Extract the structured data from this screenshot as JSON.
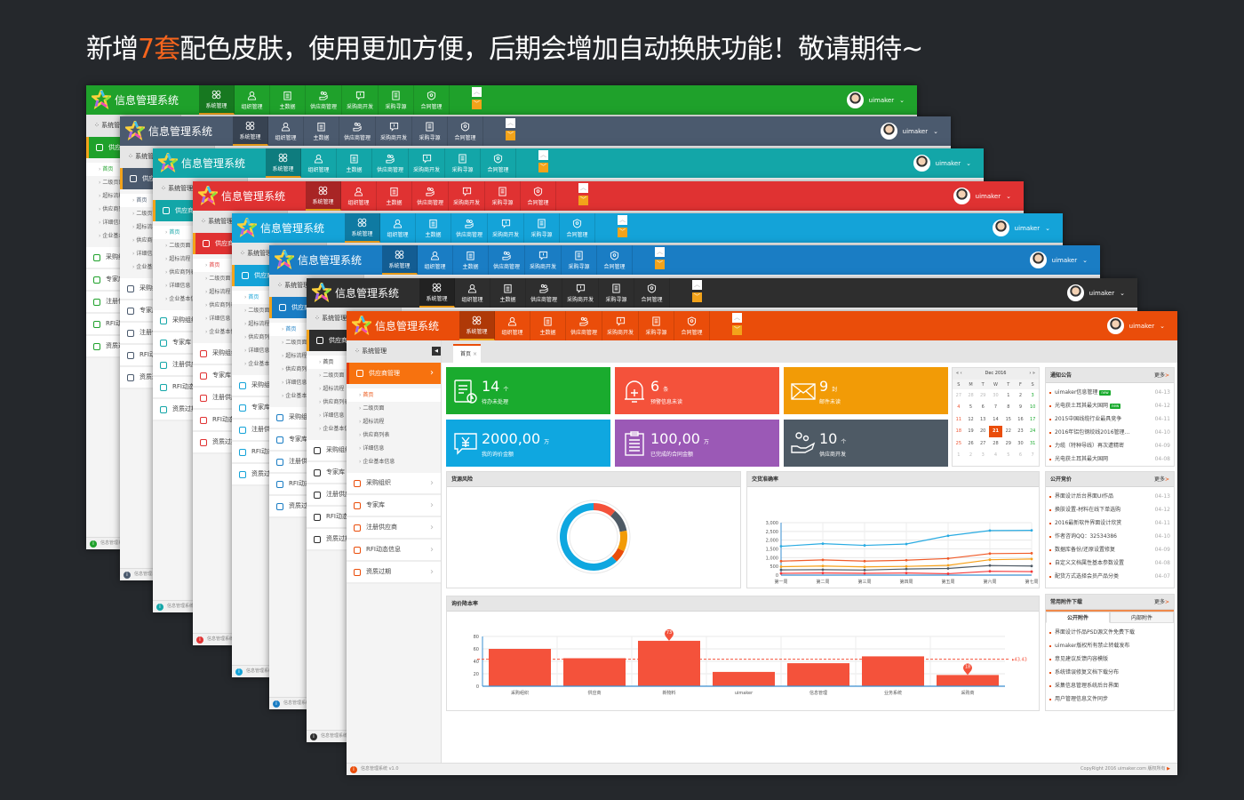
{
  "headline": {
    "prefix": "新增",
    "highlight": "7套",
    "suffix": "配色皮肤，使用更加方便，后期会增加自动换肤功能！敬请期待~"
  },
  "app": {
    "title": "信息管理系统",
    "user": "uimaker",
    "nav": [
      {
        "label": "系统管理",
        "icon": "grid-icon"
      },
      {
        "label": "组织管理",
        "icon": "user-icon"
      },
      {
        "label": "主数据",
        "icon": "clipboard-icon"
      },
      {
        "label": "供应商管理",
        "icon": "supplier-hand-icon"
      },
      {
        "label": "采购商开发",
        "icon": "chat-icon"
      },
      {
        "label": "采购寻源",
        "icon": "document-icon"
      },
      {
        "label": "合同管理",
        "icon": "shield-icon"
      }
    ],
    "sidebar": {
      "header": "系统管理",
      "active": "供应商管理",
      "subitems": [
        "首页",
        "二级页面",
        "超标流程",
        "供应商列表",
        "详细信息",
        "企业基本信息"
      ],
      "items": [
        "采购组织",
        "专家库",
        "注册供应商",
        "RFI动态信息",
        "资质过期"
      ]
    },
    "footer_version": "信息管理系统 v1.0",
    "copyright": "CopyRight 2016  uimaker.com 版权所有"
  },
  "themes": [
    {
      "name": "green",
      "color": "#1fa12b"
    },
    {
      "name": "slate",
      "color": "#4b5a6e"
    },
    {
      "name": "teal",
      "color": "#13a6a8"
    },
    {
      "name": "red",
      "color": "#e03232"
    },
    {
      "name": "sky",
      "color": "#14a3d8"
    },
    {
      "name": "blue",
      "color": "#1a7dc4"
    },
    {
      "name": "dark",
      "color": "#2e2e2e"
    },
    {
      "name": "orange",
      "color": "#ea4d0a"
    }
  ],
  "main": {
    "tab": "首页",
    "cards": [
      {
        "value": "14",
        "unit": "个",
        "label": "待办未处理",
        "color": "#1aab2e",
        "icon": "todo-clock-icon"
      },
      {
        "value": "6",
        "unit": "条",
        "label": "预警信息未读",
        "color": "#f4523b",
        "icon": "bell-icon"
      },
      {
        "value": "9",
        "unit": "封",
        "label": "邮件未读",
        "color": "#f29b06",
        "icon": "mail-icon"
      },
      {
        "value": "2000,00",
        "unit": "万",
        "label": "我的询价金额",
        "color": "#0fa7e0",
        "icon": "yen-chat-icon"
      },
      {
        "value": "100,00",
        "unit": "万",
        "label": "已完成的合同金额",
        "color": "#9b59b6",
        "icon": "clipboard-list-icon"
      },
      {
        "value": "10",
        "unit": "个",
        "label": "供应商开发",
        "color": "#4e5a65",
        "icon": "hand-icon"
      }
    ],
    "calendar": {
      "title": "Dec 2016",
      "dow": [
        "S",
        "M",
        "T",
        "W",
        "T",
        "F",
        "S"
      ],
      "weeks": [
        [
          "27",
          "28",
          "29",
          "30",
          "1",
          "2",
          "3"
        ],
        [
          "4",
          "5",
          "6",
          "7",
          "8",
          "9",
          "10"
        ],
        [
          "11",
          "12",
          "13",
          "14",
          "15",
          "16",
          "17"
        ],
        [
          "18",
          "19",
          "20",
          "21",
          "22",
          "23",
          "24"
        ],
        [
          "25",
          "26",
          "27",
          "28",
          "29",
          "30",
          "31"
        ],
        [
          "1",
          "2",
          "3",
          "4",
          "5",
          "6",
          "7"
        ]
      ],
      "selected": "21"
    },
    "notices": {
      "title": "通知公告",
      "more": "更多",
      "items": [
        {
          "text": "uimaker信息管理",
          "date": "04-13",
          "new": true
        },
        {
          "text": "光电获土耳其最大国网",
          "date": "04-12",
          "new": true
        },
        {
          "text": "2015中国线缆行业最具竞争",
          "date": "04-11"
        },
        {
          "text": "2016年铝包钢绞线2016管理...",
          "date": "04-10"
        },
        {
          "text": "力缆（特种导线）再次遭精密",
          "date": "04-09"
        },
        {
          "text": "光电获土耳其最大国网",
          "date": "04-08"
        }
      ],
      "new_label": "new"
    },
    "bidding": {
      "title": "公开竞价",
      "more": "更多",
      "items": [
        {
          "text": "界面设计后台界面UI作品",
          "date": "04-13"
        },
        {
          "text": "换肤设置-材料在线下单选购",
          "date": "04-12"
        },
        {
          "text": "2016最新软件界面设计欣赏",
          "date": "04-11"
        },
        {
          "text": "作者咨询QQ：32534386",
          "date": "04-10"
        },
        {
          "text": "数据库备份/还原设置修复",
          "date": "04-09"
        },
        {
          "text": "自定义文档属性基本参数设置",
          "date": "04-08"
        },
        {
          "text": "配货方式选择会员产品分类",
          "date": "04-07"
        }
      ]
    },
    "downloads": {
      "title": "常用附件下载",
      "more": "更多",
      "tabs": [
        "公开附件",
        "内部附件"
      ],
      "items": [
        "界面设计作品PSD源文件免费下载",
        "uimaker版权所有禁止转载发布",
        "意见建议反馈内容模版",
        "系统错误修复文档下载分布",
        "采集信息管理系统后台界面",
        "用户管理信息文件同步"
      ]
    }
  },
  "chart_data": [
    {
      "type": "pie",
      "title": "货源风险",
      "donut": true,
      "values": [
        11,
        11,
        10,
        6,
        62
      ],
      "colors": [
        "#f4523b",
        "#4e5a65",
        "#f29b06",
        "#ea4d0a",
        "#0fa7e0"
      ]
    },
    {
      "type": "line",
      "title": "交货准确率",
      "categories": [
        "第一周",
        "第二周",
        "第三周",
        "第四周",
        "第五周",
        "第六周",
        "第七周"
      ],
      "ylim": [
        0,
        3000
      ],
      "yticks": [
        "0",
        "500",
        "1,000",
        "1,500",
        "2,000",
        "2,500",
        "3,000"
      ],
      "grid": true,
      "series": [
        {
          "values": [
            1650,
            1800,
            1700,
            1780,
            2250,
            2550,
            2560
          ],
          "color": "#29abe2"
        },
        {
          "values": [
            800,
            870,
            800,
            850,
            950,
            1230,
            1250
          ],
          "color": "#f05a28"
        },
        {
          "values": [
            480,
            520,
            470,
            500,
            560,
            880,
            920
          ],
          "color": "#f7a21b"
        },
        {
          "values": [
            300,
            310,
            290,
            350,
            380,
            550,
            520
          ],
          "color": "#4e5a65"
        },
        {
          "values": [
            100,
            120,
            100,
            120,
            80,
            220,
            200
          ],
          "color": "#f4393b"
        }
      ]
    },
    {
      "type": "bar",
      "title": "询价降本率",
      "categories": [
        "采购组织",
        "供应商",
        "新物料",
        "uimaker",
        "信息管理",
        "业务系统",
        "采购商"
      ],
      "values": [
        60,
        45,
        73,
        23,
        37,
        48,
        18
      ],
      "ylim": [
        0,
        80
      ],
      "yticks": [
        "0",
        "20",
        "40",
        "60",
        "80"
      ],
      "average": 43.43,
      "average_label": "43.43",
      "max_label": "73",
      "min_label": "18",
      "color": "#f4523b",
      "grid": true
    }
  ]
}
